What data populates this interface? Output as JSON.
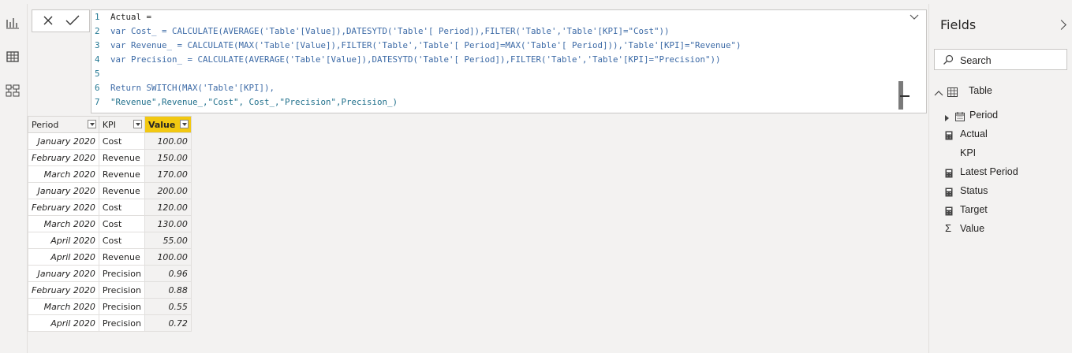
{
  "nav": {
    "report_view": "report-view-icon",
    "data_view": "data-view-icon",
    "model_view": "model-view-icon"
  },
  "formula_bar": {
    "cancel": "✕",
    "commit": "✓",
    "lines": [
      {
        "n": "1",
        "text": "Actual ="
      },
      {
        "n": "2",
        "text": "var Cost_ = CALCULATE(AVERAGE('Table'[Value]),DATESYTD('Table'[ Period]),FILTER('Table','Table'[KPI]=\"Cost\"))"
      },
      {
        "n": "3",
        "text": "var Revenue_ = CALCULATE(MAX('Table'[Value]),FILTER('Table','Table'[ Period]=MAX('Table'[ Period])),'Table'[KPI]=\"Revenue\")"
      },
      {
        "n": "4",
        "text": "var Precision_ = CALCULATE(AVERAGE('Table'[Value]),DATESYTD('Table'[ Period]),FILTER('Table','Table'[KPI]=\"Precision\"))"
      },
      {
        "n": "5",
        "text": ""
      },
      {
        "n": "6",
        "text": "Return SWITCH(MAX('Table'[KPI]),"
      },
      {
        "n": "7",
        "text": "\"Revenue\",Revenue_,\"Cost\", Cost_,\"Precision\",Precision_)"
      }
    ]
  },
  "table": {
    "headers": [
      "Period",
      "KPI",
      "Value"
    ],
    "rows": [
      [
        "January 2020",
        "Cost",
        "100.00"
      ],
      [
        "February 2020",
        "Revenue",
        "150.00"
      ],
      [
        "March 2020",
        "Revenue",
        "170.00"
      ],
      [
        "January 2020",
        "Revenue",
        "200.00"
      ],
      [
        "February 2020",
        "Cost",
        "120.00"
      ],
      [
        "March 2020",
        "Cost",
        "130.00"
      ],
      [
        "April 2020",
        "Cost",
        "55.00"
      ],
      [
        "April 2020",
        "Revenue",
        "100.00"
      ],
      [
        "January 2020",
        "Precision",
        "0.96"
      ],
      [
        "February 2020",
        "Precision",
        "0.88"
      ],
      [
        "March 2020",
        "Precision",
        "0.55"
      ],
      [
        "April 2020",
        "Precision",
        "0.72"
      ]
    ]
  },
  "fields": {
    "title": "Fields",
    "search_placeholder": "Search",
    "table_name": "Table",
    "items": [
      {
        "label": "Period",
        "icon": "calendar-icon"
      },
      {
        "label": "Actual",
        "icon": "calculator-icon"
      },
      {
        "label": "KPI",
        "icon": ""
      },
      {
        "label": "Latest Period",
        "icon": "calculator-icon"
      },
      {
        "label": "Status",
        "icon": "calculator-icon"
      },
      {
        "label": "Target",
        "icon": "calculator-icon"
      },
      {
        "label": "Value",
        "icon": "sigma-icon"
      }
    ]
  },
  "colors": {
    "accent": "#f2c811",
    "keyword": "#3c6aa6",
    "string": "#a31515"
  }
}
